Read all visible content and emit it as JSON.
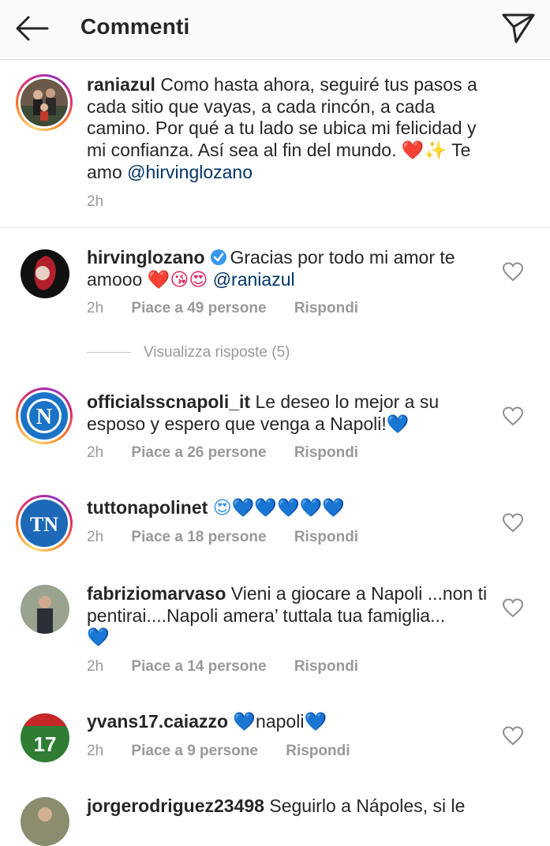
{
  "header": {
    "title": "Commenti",
    "back_icon": "arrow-left-icon",
    "send_icon": "paper-plane-icon"
  },
  "caption": {
    "username": "raniazul",
    "text_main": "Como hasta ahora, seguiré tus pasos a cada sitio que vayas, a cada rincón, a cada camino. Por qué a tu lado se ubica mi felicidad y mi confianza. Así sea al fin del mundo. ",
    "emoji": "❤️✨",
    "text_tail": " Te amo ",
    "mention": "@hirvinglozano",
    "time": "2h"
  },
  "comments": [
    {
      "username": "hirvinglozano",
      "verified": true,
      "text": "Gracias por todo mi amor te amooo ",
      "emoji": "❤️😘😍",
      "mention": "@raniazul",
      "time": "2h",
      "likes": "Piace a 49 persone",
      "reply": "Rispondi"
    },
    {
      "username": "officialsscnapoli_it",
      "text": "Le deseo lo mejor a su esposo y espero que venga a Napoli!",
      "emoji": "💙",
      "time": "2h",
      "likes": "Piace a 26 persone",
      "reply": "Rispondi"
    },
    {
      "username": "tuttonapolinet",
      "text": "",
      "emoji": "😍💙💙💙💙💙",
      "time": "2h",
      "likes": "Piace a 18 persone",
      "reply": "Rispondi"
    },
    {
      "username": "fabriziomarvaso",
      "text": "Vieni a giocare a Napoli ...non ti pentirai....Napoli amera’ tuttala tua famiglia...",
      "emoji": "💙",
      "time": "2h",
      "likes": "Piace a 14 persone",
      "reply": "Rispondi"
    },
    {
      "username": "yvans17.caiazzo",
      "text_pre_emoji": "💙",
      "text": "napoli",
      "emoji": "💙",
      "time": "2h",
      "likes": "Piace a 9 persone",
      "reply": "Rispondi"
    },
    {
      "username": "jorgerodriguez23498",
      "text": "Seguirlo a Nápoles, si le"
    }
  ],
  "view_replies": "Visualizza risposte (5)",
  "colors": {
    "text": "#262626",
    "muted": "#999999",
    "link": "#003569",
    "blue_heart": "#3897f0",
    "verified": "#3897f0"
  }
}
